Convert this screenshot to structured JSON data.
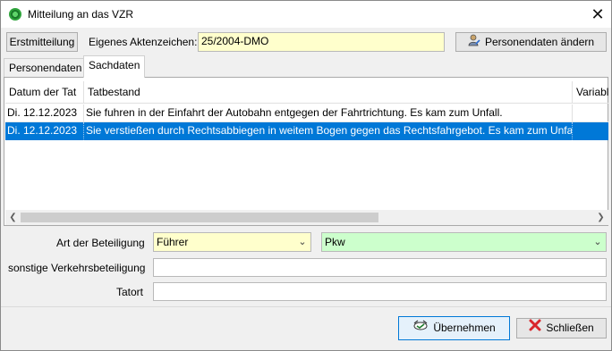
{
  "window": {
    "title": "Mitteilung an das VZR",
    "close_glyph": "✕"
  },
  "toolbar": {
    "first_notice_label": "Erstmitteilung",
    "file_ref_label": "Eigenes Aktenzeichen:",
    "file_ref_value": "25/2004-DMO",
    "change_person_label": "Personendaten ändern"
  },
  "tabs": [
    {
      "label": "Personendaten",
      "active": false
    },
    {
      "label": "Sachdaten",
      "active": true
    }
  ],
  "grid": {
    "columns": [
      "Datum der Tat",
      "Tatbestand",
      "Variabl"
    ],
    "rows": [
      {
        "date": "Di. 12.12.2023",
        "offense": "Sie fuhren in der Einfahrt der Autobahn entgegen der Fahrtrichtung. Es kam zum Unfall.",
        "variable": "",
        "selected": false
      },
      {
        "date": "Di. 12.12.2023",
        "offense": "Sie verstießen durch Rechtsabbiegen in weitem Bogen gegen das Rechtsfahrgebot. Es kam zum Unfall.",
        "variable": "",
        "selected": true
      }
    ]
  },
  "form": {
    "participation_label": "Art der Beteiligung",
    "participation_value": "Führer",
    "vehicle_value": "Pkw",
    "other_participation_label": "sonstige Verkehrsbeteiligung",
    "other_participation_value": "",
    "location_label": "Tatort",
    "location_value": ""
  },
  "buttons": {
    "apply_label": "Übernehmen",
    "close_label": "Schließen"
  },
  "icons": {
    "app": "app-icon",
    "change_person": "person-edit-icon",
    "apply": "apply-icon",
    "close": "close-x-icon"
  }
}
